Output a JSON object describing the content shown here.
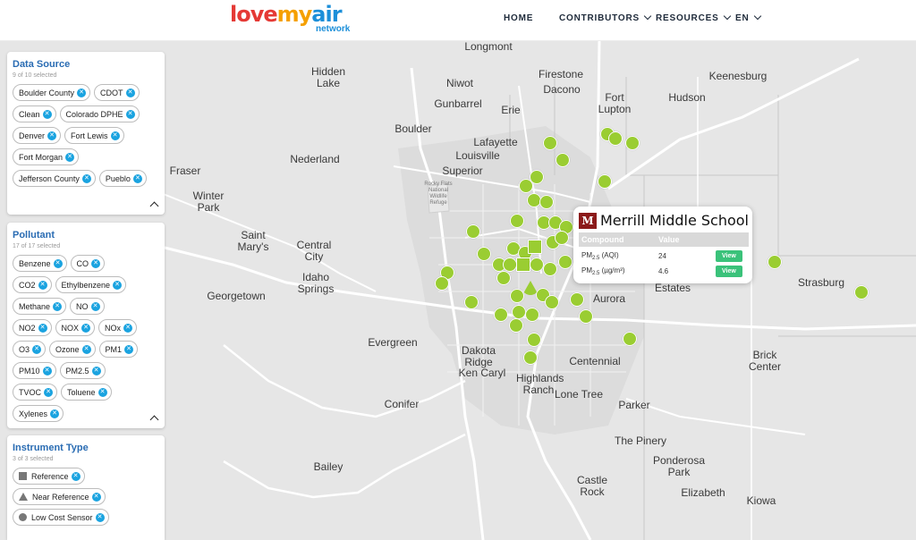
{
  "brand": {
    "word1": "love",
    "word2": "my",
    "word3": "air",
    "sub": "network"
  },
  "nav": {
    "home": "HOME",
    "contributors": "CONTRIBUTORS",
    "resources": "RESOURCES",
    "language": "EN"
  },
  "data_source": {
    "title": "Data Source",
    "subtitle": "9 of 10 selected",
    "items": [
      "Boulder County",
      "CDOT",
      "Clean",
      "Colorado DPHE",
      "Denver",
      "Fort Lewis",
      "Fort Morgan",
      "Jefferson County",
      "Pueblo"
    ]
  },
  "pollutant": {
    "title": "Pollutant",
    "subtitle": "17 of 17 selected",
    "items": [
      "Benzene",
      "CO",
      "CO2",
      "Ethylbenzene",
      "Methane",
      "NO",
      "NO2",
      "NOX",
      "NOx",
      "O3",
      "Ozone",
      "PM1",
      "PM10",
      "PM2.5",
      "TVOC",
      "Toluene",
      "Xylenes"
    ]
  },
  "instrument": {
    "title": "Instrument Type",
    "subtitle": "3 of 3 selected",
    "items": [
      "Reference",
      "Near Reference",
      "Low Cost Sensor"
    ]
  },
  "popup": {
    "logo_letter": "M",
    "name": "Merrill Middle School",
    "col_compound": "Compound",
    "col_value": "Value",
    "rows": [
      {
        "compound": "PM2.5 (AQI)",
        "value": "24",
        "button": "View"
      },
      {
        "compound": "PM2.5 (µg/m³)",
        "value": "4.6",
        "button": "View"
      }
    ]
  },
  "map_labels": [
    "Longmont",
    "Hidden Lake",
    "Niwot",
    "Firestone",
    "Dacono",
    "Fort Lupton",
    "Hudson",
    "Keenesburg",
    "Gunbarrel",
    "Erie",
    "Boulder",
    "Lafayette",
    "Louisville",
    "Superior",
    "Nederland",
    "Fraser",
    "Winter Park",
    "Saint Mary's",
    "Central City",
    "Idaho Springs",
    "Georgetown",
    "Evergreen",
    "Aurora",
    "Centennial",
    "Highlands Ranch",
    "Lone Tree",
    "Parker",
    "Dakota Ridge",
    "Ken Caryl",
    "Conifer",
    "Bailey",
    "The Pinery",
    "Ponderosa Park",
    "Castle Rock",
    "Elizabeth",
    "Kiowa",
    "Strasburg",
    "Brick Center",
    "Estates",
    "Rocky Flats National Wildlife Refuge"
  ],
  "colors": {
    "marker": "#9acd32",
    "chip_x": "#1aa3e0",
    "title_blue": "#2a6cb3",
    "view_button": "#3ac27a"
  },
  "marker_legend": "marker-icon"
}
